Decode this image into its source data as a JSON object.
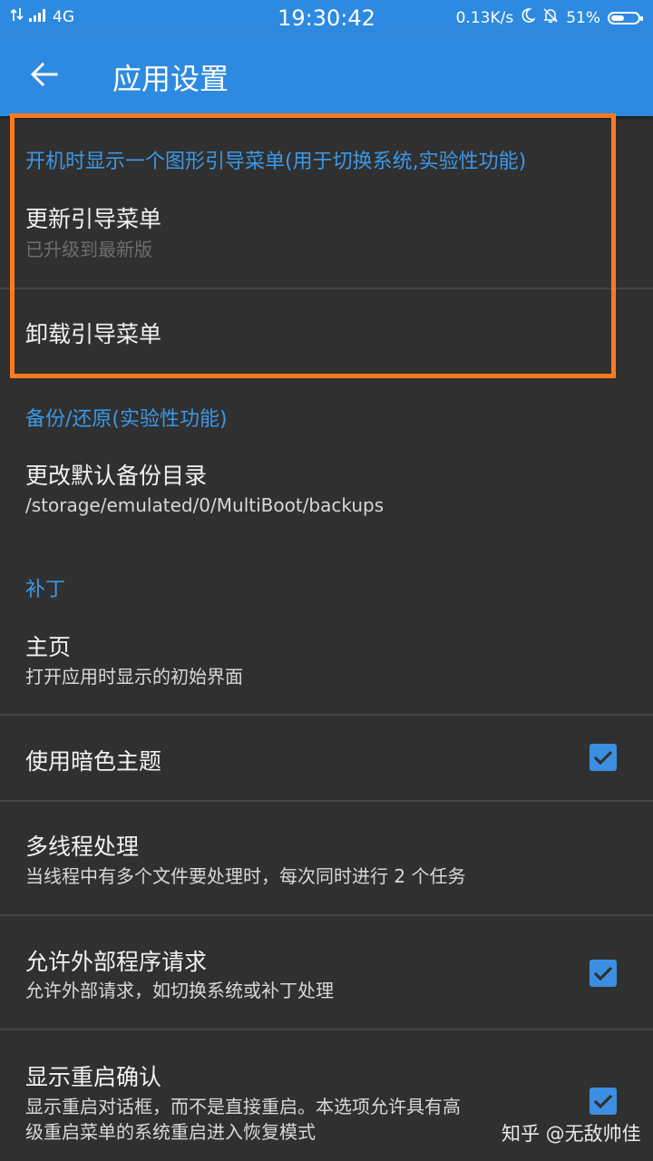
{
  "status_bar": {
    "network": "4G",
    "time": "19:30:42",
    "speed": "0.13K/s",
    "battery": "51%",
    "battery_level": 0.51
  },
  "app_bar": {
    "title": "应用设置"
  },
  "sections": {
    "bootmenu": {
      "header": "开机时显示一个图形引导菜单(用于切换系统,实验性功能)",
      "update": {
        "title": "更新引导菜单",
        "subtitle": "已升级到最新版"
      },
      "uninstall": {
        "title": "卸载引导菜单"
      }
    },
    "backup": {
      "header": "备份/还原(实验性功能)",
      "directory": {
        "title": "更改默认备份目录",
        "subtitle": "/storage/emulated/0/MultiBoot/backups"
      }
    },
    "patch": {
      "header": "补丁",
      "homepage": {
        "title": "主页",
        "subtitle": "打开应用时显示的初始界面"
      },
      "dark_theme": {
        "title": "使用暗色主题",
        "checked": true
      },
      "multithread": {
        "title": "多线程处理",
        "subtitle": "当线程中有多个文件要处理时，每次同时进行 2 个任务"
      },
      "external": {
        "title": "允许外部程序请求",
        "subtitle": "允许外部请求，如切换系统或补丁处理",
        "checked": true
      },
      "reboot_confirm": {
        "title": "显示重启确认",
        "subtitle_line1": "显示重启对话框，而不是直接重启。本选项允许具有高",
        "subtitle_line2": "级重启菜单的系统重启进入恢复模式",
        "checked": true
      }
    }
  },
  "watermark": "知乎 @无敌帅佳",
  "colors": {
    "primary": "#2E8AE0",
    "accent": "#3B98E8",
    "background": "#303030",
    "highlight": "#FF7A1F"
  }
}
